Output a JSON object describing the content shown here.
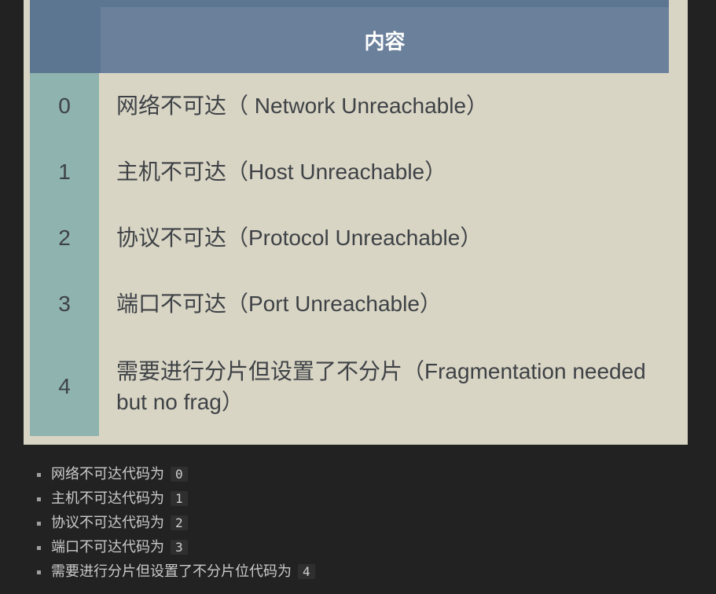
{
  "table": {
    "header_label": "内容",
    "rows": [
      {
        "code": "0",
        "desc": "网络不可达（ Network Unreachable）"
      },
      {
        "code": "1",
        "desc": "主机不可达（Host Unreachable）"
      },
      {
        "code": "2",
        "desc": "协议不可达（Protocol Unreachable）"
      },
      {
        "code": "3",
        "desc": "端口不可达（Port Unreachable）"
      },
      {
        "code": "4",
        "desc": "需要进行分片但设置了不分片（Fragmentation needed but no frag）"
      }
    ]
  },
  "bullets": [
    {
      "text": "网络不可达代码为",
      "code": "0"
    },
    {
      "text": "主机不可达代码为",
      "code": "1"
    },
    {
      "text": "协议不可达代码为",
      "code": "2"
    },
    {
      "text": "端口不可达代码为",
      "code": "3"
    },
    {
      "text": "需要进行分片但设置了不分片位代码为",
      "code": "4"
    }
  ]
}
